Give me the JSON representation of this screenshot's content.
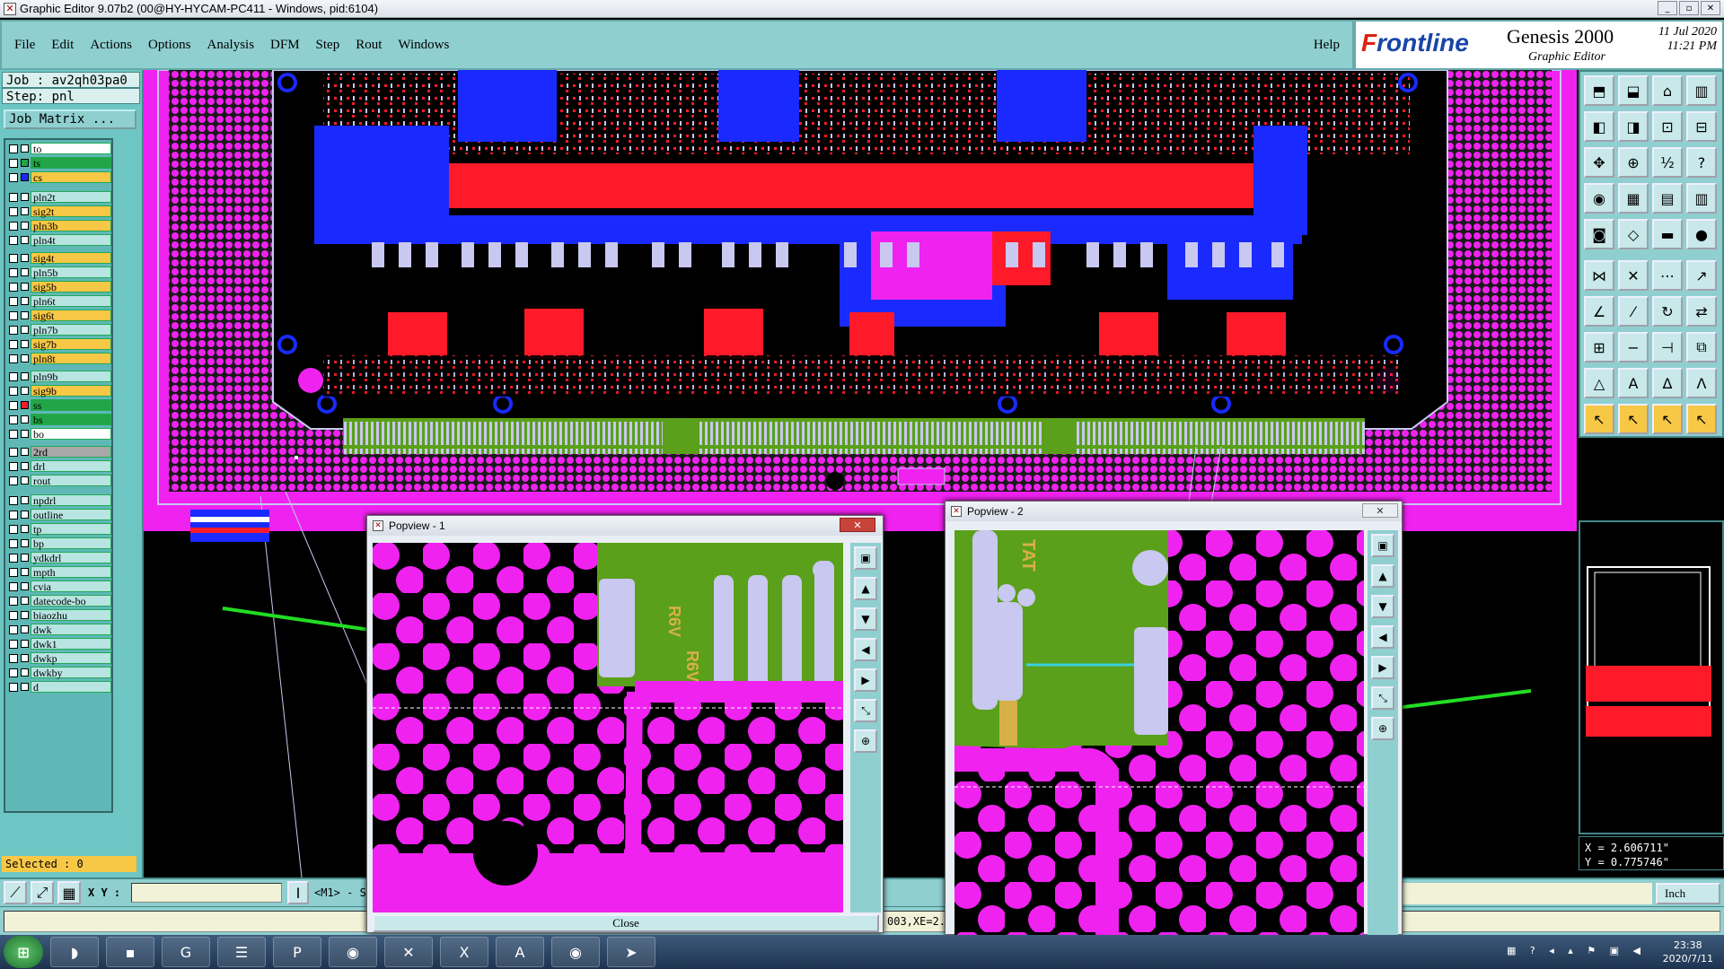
{
  "window": {
    "title": "Graphic Editor 9.07b2 (00@HY-HYCAM-PC411 - Windows, pid:6104)",
    "buttons": [
      "_",
      "▫",
      "✕"
    ]
  },
  "menu": [
    "File",
    "Edit",
    "Actions",
    "Options",
    "Analysis",
    "DFM",
    "Step",
    "Rout",
    "Windows"
  ],
  "help_label": "Help",
  "brand": {
    "logo_f": "F",
    "logo_rest": "rontline",
    "product": "Genesis 2000",
    "subtitle": "Graphic Editor",
    "date": "11 Jul 2020",
    "time": "11:21 PM"
  },
  "job": {
    "job_line": "Job : av2qh03pa0",
    "step_line": "Step: pnl",
    "matrix_label": "Job Matrix ..."
  },
  "layers": [
    {
      "name": "to",
      "color": "#ffffff"
    },
    {
      "name": "ts",
      "color": "#21a546"
    },
    {
      "name": "cs",
      "color": "#f7c746"
    },
    {
      "name": "pln2t",
      "color": "#b8e4e2"
    },
    {
      "name": "sig2t",
      "color": "#f7c746"
    },
    {
      "name": "pln3b",
      "color": "#f7c746"
    },
    {
      "name": "pln4t",
      "color": "#b8e4e2"
    },
    {
      "name": "sig4t",
      "color": "#f7c746"
    },
    {
      "name": "pln5b",
      "color": "#b8e4e2"
    },
    {
      "name": "sig5b",
      "color": "#f7c746"
    },
    {
      "name": "pln6t",
      "color": "#b8e4e2"
    },
    {
      "name": "sig6t",
      "color": "#f7c746"
    },
    {
      "name": "pln7b",
      "color": "#b8e4e2"
    },
    {
      "name": "sig7b",
      "color": "#f7c746"
    },
    {
      "name": "pln8t",
      "color": "#f7c746"
    },
    {
      "name": "pln9b",
      "color": "#b8e4e2"
    },
    {
      "name": "sig9b",
      "color": "#f7c746"
    },
    {
      "name": "ss",
      "color": "#21a546"
    },
    {
      "name": "bs",
      "color": "#21a546"
    },
    {
      "name": "bo",
      "color": "#ffffff"
    },
    {
      "name": "2rd",
      "color": "#a8a8a8"
    },
    {
      "name": "drl",
      "color": "#b8e4e2"
    },
    {
      "name": "rout",
      "color": "#b8e4e2"
    },
    {
      "name": "npdrl",
      "color": "#b8e4e2"
    },
    {
      "name": "outline",
      "color": "#b8e4e2"
    },
    {
      "name": "tp",
      "color": "#b8e4e2"
    },
    {
      "name": "bp",
      "color": "#b8e4e2"
    },
    {
      "name": "ydkdrl",
      "color": "#b8e4e2"
    },
    {
      "name": "mpth",
      "color": "#b8e4e2"
    },
    {
      "name": "cvia",
      "color": "#b8e4e2"
    },
    {
      "name": "datecode-bo",
      "color": "#b8e4e2"
    },
    {
      "name": "biaozhu",
      "color": "#b8e4e2"
    },
    {
      "name": "dwk",
      "color": "#b8e4e2"
    },
    {
      "name": "dwk1",
      "color": "#b8e4e2"
    },
    {
      "name": "dwkp",
      "color": "#b8e4e2"
    },
    {
      "name": "dwkby",
      "color": "#b8e4e2"
    },
    {
      "name": "d",
      "color": "#b8e4e2"
    }
  ],
  "selected_text": "Selected : 0",
  "bottom": {
    "xy_label": "X Y :",
    "mi_text": "<M1> - S",
    "unit": "Inch",
    "status_value": "003,XE=2."
  },
  "coords": {
    "x": "X = 2.606711\"",
    "y": "Y = 0.775746\""
  },
  "popview1": {
    "title": "Popview - 1",
    "close": "Close",
    "x_label": "✕"
  },
  "popview2": {
    "title": "Popview - 2",
    "x_label": "✕"
  },
  "pcb_text": {
    "a": "R6V",
    "b": "R6V",
    "c": "TAT"
  },
  "taskbar": {
    "time": "23:38",
    "date": "2020/7/11"
  },
  "colors": {
    "magenta": "#f022f0",
    "green": "#5aa01a",
    "red": "#ff1a2a",
    "blue": "#1a2aff",
    "lavender": "#c8c8f0",
    "yellow": "#f7c746",
    "teal": "#8fcfd0"
  }
}
